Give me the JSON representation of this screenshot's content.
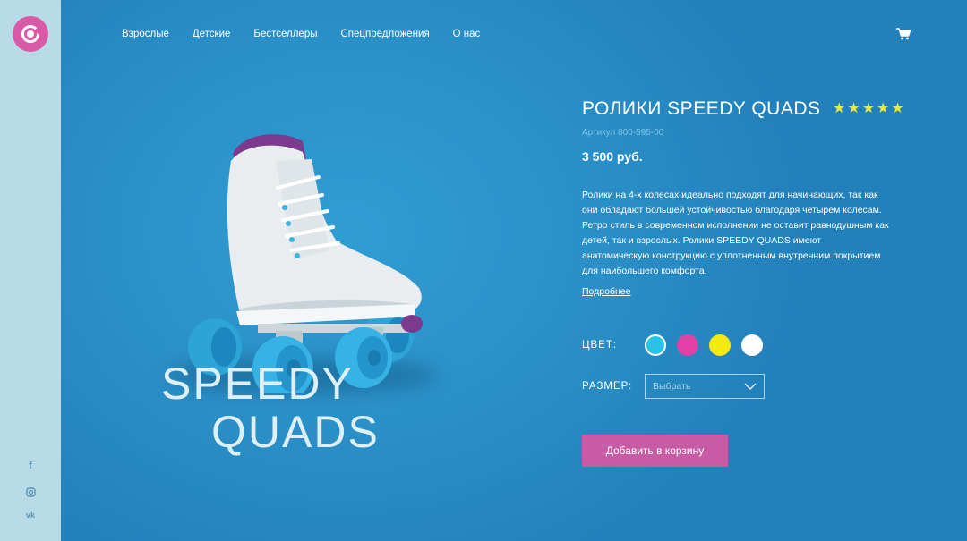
{
  "nav": {
    "items": [
      "Взрослые",
      "Детские",
      "Бестселлеры",
      "Спецпредложения",
      "О нас"
    ]
  },
  "icons": {
    "logo": "logo-icon",
    "cart": "cart-icon",
    "social": [
      "facebook-icon",
      "instagram-icon",
      "vk-icon"
    ]
  },
  "hero": {
    "brand_line1": "SPEEDY",
    "brand_line2": "QUADS"
  },
  "product": {
    "title": "РОЛИКИ SPEEDY QUADS",
    "rating": 5,
    "rating_max": 5,
    "sku": "Артикул 800-595-00",
    "price": "3 500 руб.",
    "description": "Ролики на 4-х колесах идеально подходят для начинающих, так как они обладают большей устойчивостью благодаря четырем колесам. Ретро стиль в современном исполнении не оставит равнодушным как детей, так и взрослых. Ролики SPEEDY QUADS имеют анатомическую конструкцию с уплотненным внутренним покрытием для наибольшего комфорта.",
    "more_link": "Подробнее",
    "color_label": "ЦВЕТ:",
    "colors": [
      "#29c3e8",
      "#e23fa8",
      "#f4ea10",
      "#ffffff"
    ],
    "selected_color": 0,
    "size_label": "РАЗМЕР:",
    "size_placeholder": "Выбрать",
    "add_to_cart": "Добавить в корзину"
  },
  "theme": {
    "accent": "#c85ca4",
    "sidebar": "#b9dbe8",
    "background": "#2a8fc7",
    "star": "#e8ea3a"
  }
}
